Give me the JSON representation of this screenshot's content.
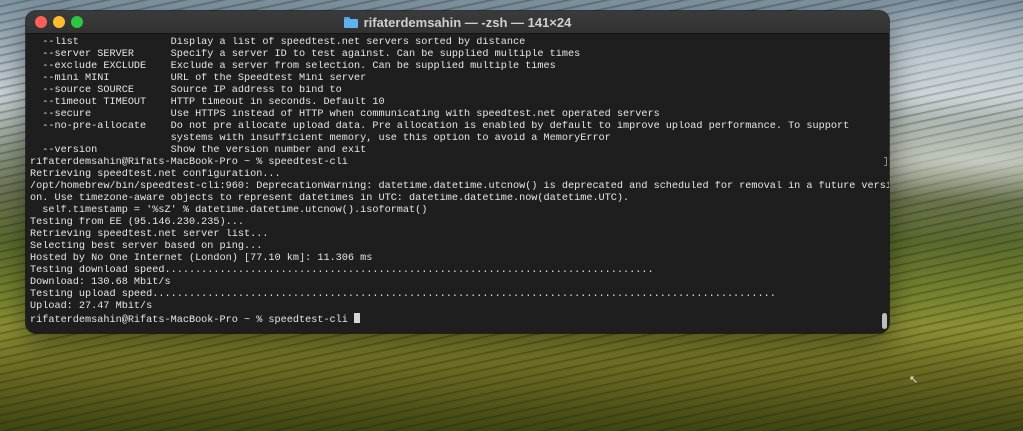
{
  "window": {
    "title": "rifaterdemsahin — -zsh — 141×24"
  },
  "terminal": {
    "lines": [
      "  --list               Display a list of speedtest.net servers sorted by distance",
      "  --server SERVER      Specify a server ID to test against. Can be supplied multiple times",
      "  --exclude EXCLUDE    Exclude a server from selection. Can be supplied multiple times",
      "  --mini MINI          URL of the Speedtest Mini server",
      "  --source SOURCE      Source IP address to bind to",
      "  --timeout TIMEOUT    HTTP timeout in seconds. Default 10",
      "  --secure             Use HTTPS instead of HTTP when communicating with speedtest.net operated servers",
      "  --no-pre-allocate    Do not pre allocate upload data. Pre allocation is enabled by default to improve upload performance. To support",
      "                       systems with insufficient memory, use this option to avoid a MemoryError",
      "  --version            Show the version number and exit",
      "rifaterdemsahin@Rifats-MacBook-Pro ~ % speedtest-cli",
      "Retrieving speedtest.net configuration...",
      "/opt/homebrew/bin/speedtest-cli:960: DeprecationWarning: datetime.datetime.utcnow() is deprecated and scheduled for removal in a future versi",
      "on. Use timezone-aware objects to represent datetimes in UTC: datetime.datetime.now(datetime.UTC).",
      "  self.timestamp = '%sZ' % datetime.datetime.utcnow().isoformat()",
      "Testing from EE (95.146.230.235)...",
      "Retrieving speedtest.net server list...",
      "Selecting best server based on ping...",
      "Hosted by No One Internet (London) [77.10 km]: 11.306 ms",
      "Testing download speed................................................................................",
      "Download: 130.68 Mbit/s",
      "Testing upload speed......................................................................................................",
      "Upload: 27.47 Mbit/s"
    ],
    "prompt": "rifaterdemsahin@Rifats-MacBook-Pro ~ % speedtest-cli "
  }
}
